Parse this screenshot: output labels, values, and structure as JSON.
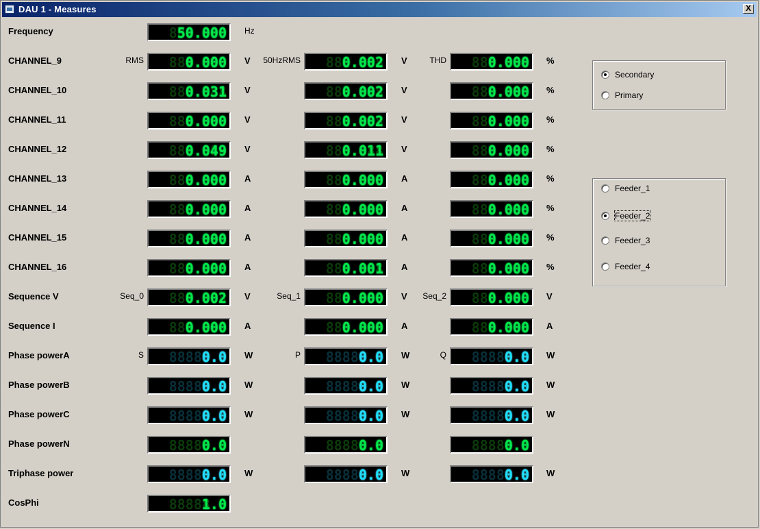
{
  "window": {
    "title": "DAU 1 - Measures",
    "close_label": "X"
  },
  "frequency": {
    "label": "Frequency",
    "value": "50.000",
    "unit": "Hz"
  },
  "column_prefixes": {
    "rms": "RMS",
    "rms50": "50HzRMS",
    "thd": "THD"
  },
  "channels": [
    {
      "label": "CHANNEL_9",
      "rms": "0.000",
      "rms50": "0.002",
      "thd": "0.000",
      "unit": "V"
    },
    {
      "label": "CHANNEL_10",
      "rms": "0.031",
      "rms50": "0.002",
      "thd": "0.000",
      "unit": "V"
    },
    {
      "label": "CHANNEL_11",
      "rms": "0.000",
      "rms50": "0.002",
      "thd": "0.000",
      "unit": "V"
    },
    {
      "label": "CHANNEL_12",
      "rms": "0.049",
      "rms50": "0.011",
      "thd": "0.000",
      "unit": "V"
    },
    {
      "label": "CHANNEL_13",
      "rms": "0.000",
      "rms50": "0.000",
      "thd": "0.000",
      "unit": "A"
    },
    {
      "label": "CHANNEL_14",
      "rms": "0.000",
      "rms50": "0.000",
      "thd": "0.000",
      "unit": "A"
    },
    {
      "label": "CHANNEL_15",
      "rms": "0.000",
      "rms50": "0.000",
      "thd": "0.000",
      "unit": "A"
    },
    {
      "label": "CHANNEL_16",
      "rms": "0.000",
      "rms50": "0.001",
      "thd": "0.000",
      "unit": "A"
    }
  ],
  "thd_unit": "%",
  "sequence_v": {
    "label": "Sequence V",
    "prefixes": [
      "Seq_0",
      "Seq_1",
      "Seq_2"
    ],
    "values": [
      "0.002",
      "0.000",
      "0.000"
    ],
    "unit": "V"
  },
  "sequence_i": {
    "label": "Sequence I",
    "values": [
      "0.000",
      "0.000",
      "0.000"
    ],
    "unit": "A"
  },
  "power_prefixes": [
    "S",
    "P",
    "Q"
  ],
  "power_rows": [
    {
      "label": "Phase powerA",
      "values": [
        "0.0",
        "0.0",
        "0.0"
      ],
      "unit": "W",
      "color": "cyan"
    },
    {
      "label": "Phase powerB",
      "values": [
        "0.0",
        "0.0",
        "0.0"
      ],
      "unit": "W",
      "color": "cyan"
    },
    {
      "label": "Phase powerC",
      "values": [
        "0.0",
        "0.0",
        "0.0"
      ],
      "unit": "W",
      "color": "cyan"
    },
    {
      "label": "Phase powerN",
      "values": [
        "0.0",
        "0.0",
        "0.0"
      ],
      "unit": "",
      "color": "green"
    },
    {
      "label": "Triphase power",
      "values": [
        "0.0",
        "0.0",
        "0.0"
      ],
      "unit": "W",
      "color": "cyan"
    }
  ],
  "cosphi": {
    "label": "CosPhi",
    "value": "1.0"
  },
  "value_mode": {
    "options": [
      "Secondary",
      "Primary"
    ],
    "selected": "Secondary"
  },
  "feeder": {
    "options": [
      "Feeder_1",
      "Feeder_2",
      "Feeder_3",
      "Feeder_4"
    ],
    "selected": "Feeder_2"
  },
  "colors": {
    "lcd_green": "#00e84c",
    "lcd_cyan": "#1ee0ff",
    "face": "#d4d0c8",
    "title_start": "#0a246a"
  }
}
